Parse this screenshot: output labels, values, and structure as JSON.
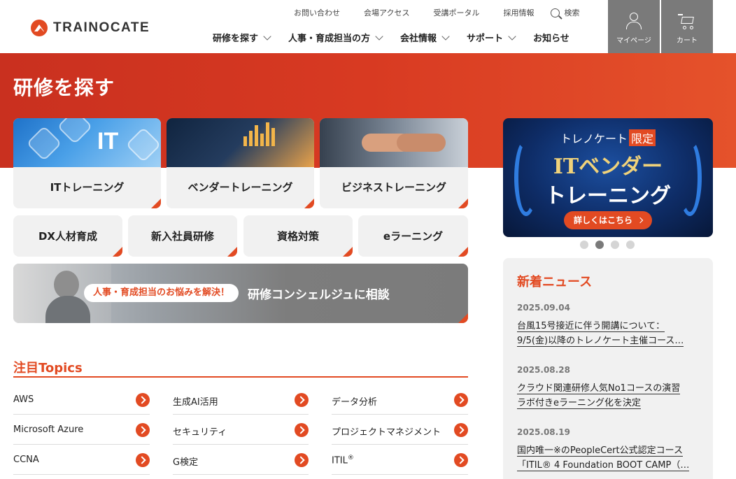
{
  "header": {
    "logo_text": "TRAINOCATE",
    "util_links": [
      "お問い合わせ",
      "会場アクセス",
      "受講ポータル",
      "採用情報"
    ],
    "search_label": "検索",
    "gnav": [
      {
        "label": "研修を探す",
        "dropdown": true
      },
      {
        "label": "人事・育成担当の方",
        "dropdown": true
      },
      {
        "label": "会社情報",
        "dropdown": true
      },
      {
        "label": "サポート",
        "dropdown": true
      },
      {
        "label": "お知らせ",
        "dropdown": false
      }
    ],
    "mypage_label": "マイページ",
    "cart_label": "カート"
  },
  "hero": {
    "title": "研修を探す"
  },
  "cards_top": [
    {
      "label": "ITトレーニング"
    },
    {
      "label": "ベンダートレーニング"
    },
    {
      "label": "ビジネストレーニング"
    }
  ],
  "cards_bottom": [
    {
      "label": "DX人材育成"
    },
    {
      "label": "新入社員研修"
    },
    {
      "label": "資格対策"
    },
    {
      "label": "eラーニング"
    }
  ],
  "it_image_text": "IT",
  "concierge": {
    "pill": "人事・育成担当のお悩みを解決！",
    "main": "研修コンシェルジュに相談"
  },
  "topics": {
    "title": "注目Topics",
    "items": [
      [
        "AWS",
        "生成AI活用",
        "データ分析"
      ],
      [
        "Microsoft Azure",
        "セキュリティ",
        "プロジェクトマネジメント"
      ],
      [
        "CCNA",
        "G検定",
        "ITIL"
      ]
    ],
    "itil_mark": "®"
  },
  "banner": {
    "line_top": "トレノケート",
    "tag": "限定",
    "line1": "ITベンダー",
    "line2": "トレーニング",
    "cta": "詳しくはこちら"
  },
  "carousel": {
    "count": 4,
    "active": 1
  },
  "news": {
    "title": "新着ニュース",
    "items": [
      {
        "date": "2025.09.04",
        "lines": [
          "台風15号接近に伴う開講について：",
          "9/5(金)以降のトレノケート主催コース…"
        ]
      },
      {
        "date": "2025.08.28",
        "lines": [
          "クラウド関連研修人気No1コースの演習",
          "ラボ付きeラーニング化を決定"
        ]
      },
      {
        "date": "2025.08.19",
        "lines": [
          "国内唯一※のPeopleCert公式認定コース",
          "「ITIL® 4 Foundation BOOT CAMP（…"
        ]
      }
    ]
  },
  "colors": {
    "brand": "#e24a22",
    "header_button": "#7a7a7a",
    "card_bg": "#f1f1f1"
  }
}
